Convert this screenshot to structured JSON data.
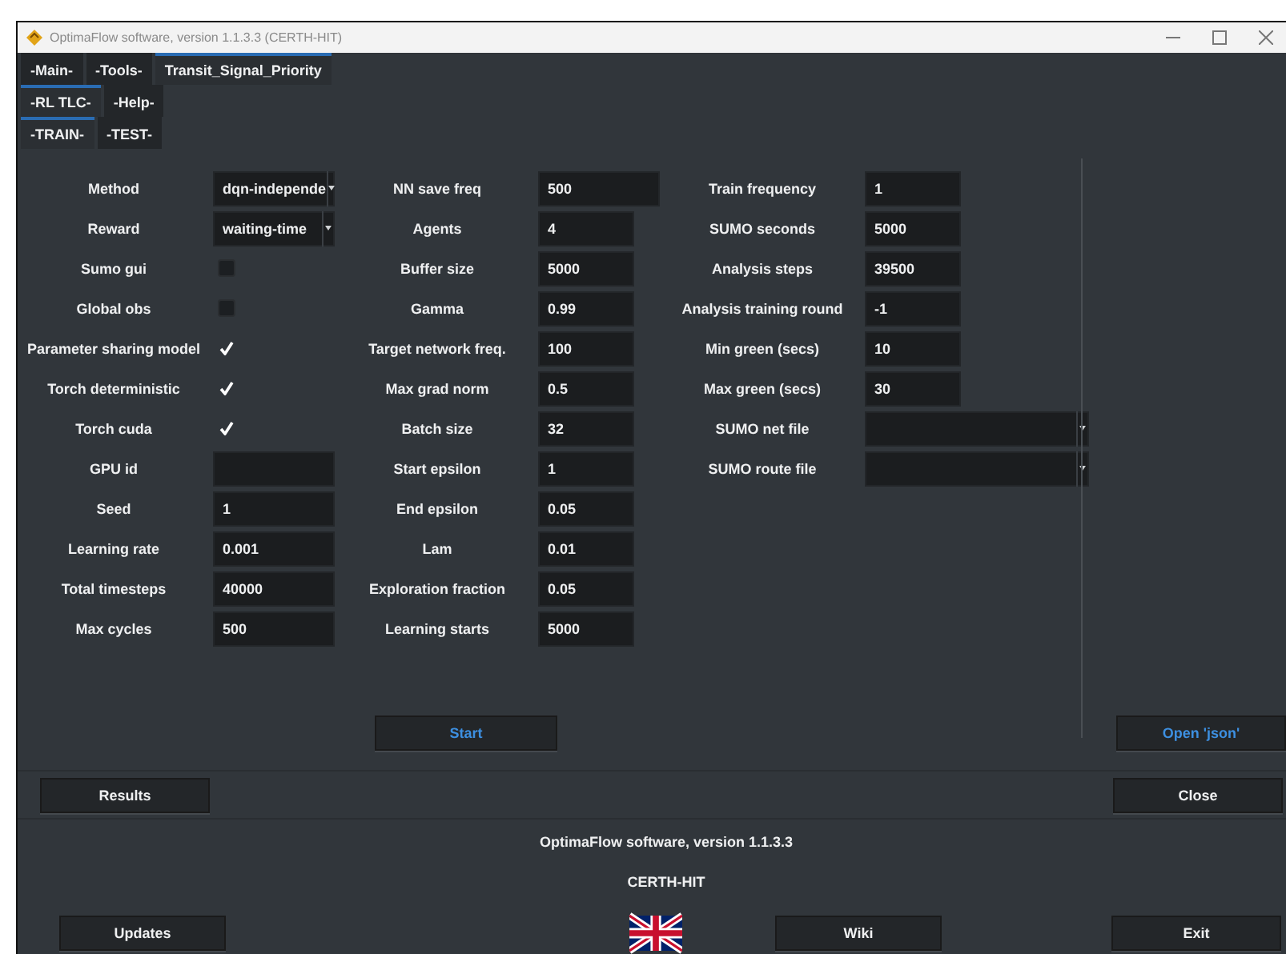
{
  "window": {
    "title": "OptimaFlow software, version 1.1.3.3 (CERTH-HIT)"
  },
  "tab_rows": [
    [
      {
        "label": "-Main-",
        "selected": false
      },
      {
        "label": "-Tools-",
        "selected": false
      },
      {
        "label": "Transit_Signal_Priority",
        "selected": true
      }
    ],
    [
      {
        "label": "-RL TLC-",
        "selected": true
      },
      {
        "label": "-Help-",
        "selected": false
      }
    ],
    [
      {
        "label": "-TRAIN-",
        "selected": true
      },
      {
        "label": "-TEST-",
        "selected": false
      }
    ]
  ],
  "form": {
    "columns": [
      [
        {
          "label": "Method",
          "kind": "dropdown",
          "value": "dqn-independe"
        },
        {
          "label": "Reward",
          "kind": "dropdown",
          "value": "waiting-time"
        },
        {
          "label": "Sumo gui",
          "kind": "checkbox",
          "checked": false
        },
        {
          "label": "Global obs",
          "kind": "checkbox",
          "checked": false
        },
        {
          "label": "Parameter sharing model",
          "kind": "checkbox",
          "checked": true
        },
        {
          "label": "Torch deterministic",
          "kind": "checkbox",
          "checked": true
        },
        {
          "label": "Torch cuda",
          "kind": "checkbox",
          "checked": true
        },
        {
          "label": "GPU id",
          "kind": "text"
        },
        {
          "label": "Seed",
          "kind": "text",
          "value": "1"
        },
        {
          "label": "Learning rate",
          "kind": "text",
          "value": "0.001"
        },
        {
          "label": "Total timesteps",
          "kind": "text",
          "value": "40000"
        },
        {
          "label": "Max cycles",
          "kind": "text",
          "value": "500"
        }
      ],
      [
        {
          "label": "NN save freq",
          "kind": "text",
          "value": "500"
        },
        {
          "label": "Agents",
          "kind": "text",
          "value": "4"
        },
        {
          "label": "Buffer size",
          "kind": "text",
          "value": "5000"
        },
        {
          "label": "Gamma",
          "kind": "text",
          "value": "0.99"
        },
        {
          "label": "Target network freq.",
          "kind": "text",
          "value": "100"
        },
        {
          "label": "Max grad norm",
          "kind": "text",
          "value": "0.5"
        },
        {
          "label": "Batch size",
          "kind": "text",
          "value": "32"
        },
        {
          "label": "Start epsilon",
          "kind": "text",
          "value": "1"
        },
        {
          "label": "End epsilon",
          "kind": "text",
          "value": "0.05"
        },
        {
          "label": "Lam",
          "kind": "text",
          "value": "0.01"
        },
        {
          "label": "Exploration fraction",
          "kind": "text",
          "value": "0.05"
        },
        {
          "label": "Learning starts",
          "kind": "text",
          "value": "5000"
        }
      ],
      [
        {
          "label": "Train frequency",
          "kind": "text",
          "value": "1"
        },
        {
          "label": "SUMO seconds",
          "kind": "text",
          "value": "5000"
        },
        {
          "label": "Analysis steps",
          "kind": "text",
          "value": "39500"
        },
        {
          "label": "Analysis training round",
          "kind": "text",
          "value": "-1"
        },
        {
          "label": "Min green (secs)",
          "kind": "text",
          "value": "10"
        },
        {
          "label": "Max green (secs)",
          "kind": "text",
          "value": "30"
        },
        {
          "label": "SUMO net file",
          "kind": "file"
        },
        {
          "label": "SUMO route file",
          "kind": "file"
        }
      ]
    ]
  },
  "start_button": "Start",
  "open_json_button": "Open 'json'",
  "results_button": "Results",
  "close_button": "Close",
  "footer": {
    "version": "OptimaFlow software, version 1.1.3.3",
    "organization": "CERTH-HIT"
  },
  "bottom_buttons": {
    "updates": "Updates",
    "wiki": "Wiki",
    "exit": "Exit"
  }
}
